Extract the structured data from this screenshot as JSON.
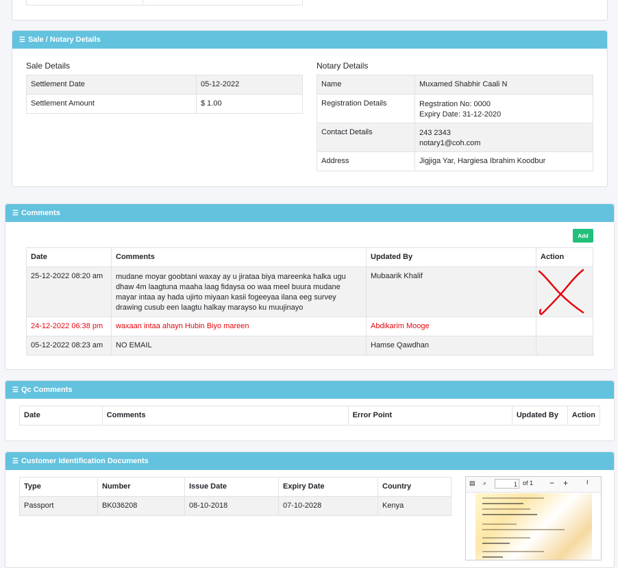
{
  "sale_notary": {
    "title": "Sale / Notary Details",
    "sale_heading": "Sale Details",
    "sale_rows": [
      {
        "label": "Settlement Date",
        "value": "05-12-2022"
      },
      {
        "label": "Settlement Amount",
        "value": "$ 1.00"
      }
    ],
    "notary_heading": "Notary Details",
    "notary_rows": [
      {
        "label": "Name",
        "value": "Muxamed Shabhir Caali N",
        "value2": ""
      },
      {
        "label": "Registration Details",
        "value": "Regstration No: 0000",
        "value2": "Expiry Date: 31-12-2020"
      },
      {
        "label": "Contact Details",
        "value": "243 2343",
        "value2": "notary1@coh.com"
      },
      {
        "label": "Address",
        "value": "Jigjiga Yar, Hargiesa Ibrahim Koodbur",
        "value2": ""
      }
    ]
  },
  "comments": {
    "title": "Comments",
    "add_label": "Add",
    "headers": [
      "Date",
      "Comments",
      "Updated By",
      "Action"
    ],
    "rows": [
      {
        "date": "25-12-2022 08:20 am",
        "comment": "mudane moyar goobtani waxay ay u jirataa biya mareenka halka ugu dhaw 4m laagtuna maaha laag fidaysa oo waa meel buura mudane mayar intaa ay hada ujirto miyaan kasii fogeeyaa ilana eeg survey drawing cusub een laagtu halkay marayso ku muujinayo",
        "by": "Mubaarik Khalif"
      },
      {
        "date": "24-12-2022 06:38 pm",
        "comment": "waxaan intaa ahayn Hubin Biyo mareen",
        "by": "Abdikarim Mooge"
      },
      {
        "date": "05-12-2022 08:23 am",
        "comment": "NO EMAIL",
        "by": "Hamse Qawdhan"
      }
    ],
    "accent_red": "#e3060d"
  },
  "qc_comments": {
    "title": "Qc Comments",
    "headers": [
      "Date",
      "Comments",
      "Error Point",
      "Updated By",
      "Action"
    ]
  },
  "customer_docs": {
    "title": "Customer Identification Documents",
    "headers": [
      "Type",
      "Number",
      "Issue Date",
      "Expiry Date",
      "Country"
    ],
    "rows": [
      {
        "type": "Passport",
        "number": "BK036208",
        "issue": "08-10-2018",
        "expiry": "07-10-2028",
        "country": "Kenya"
      }
    ],
    "pdf": {
      "page": "1",
      "of": "of 1"
    }
  }
}
